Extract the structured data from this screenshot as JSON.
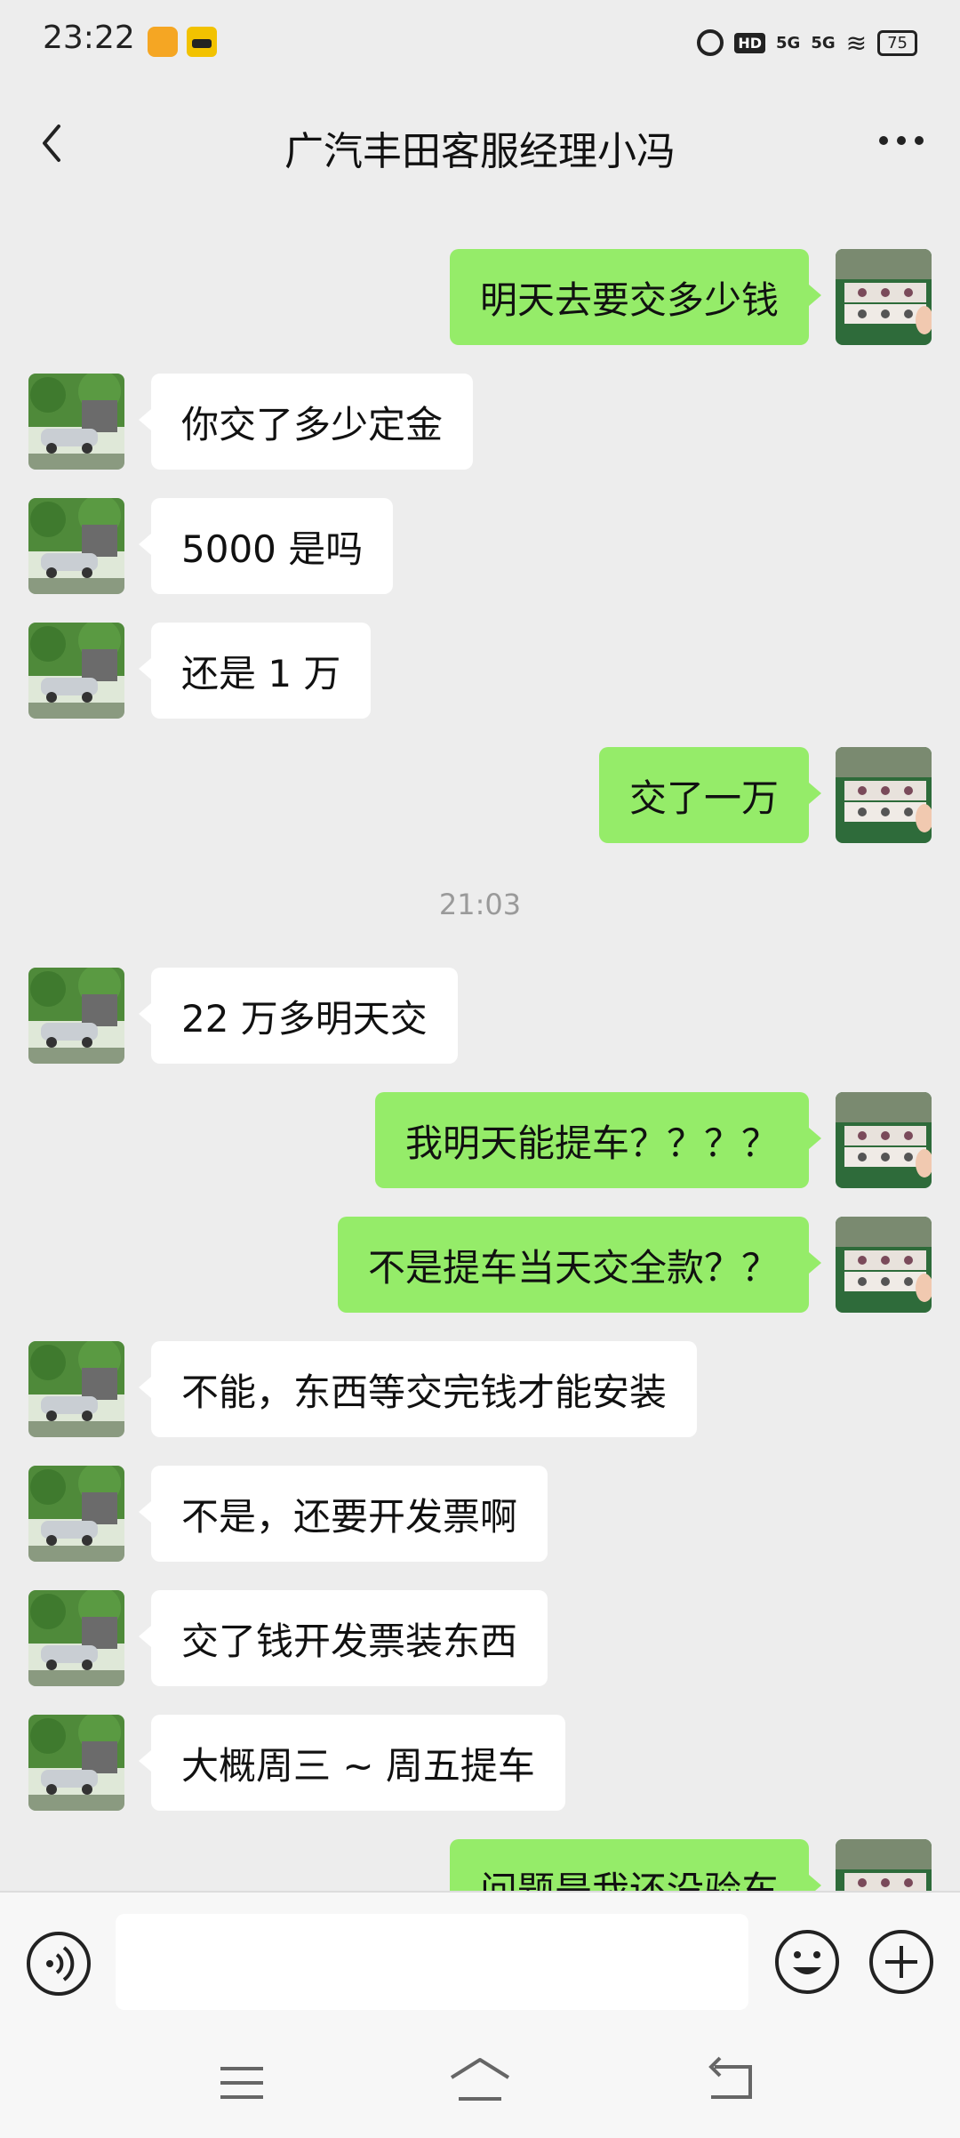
{
  "status_bar": {
    "time": "23:22",
    "hd_label": "HD",
    "network1": "5G",
    "network2": "5G",
    "battery": "75"
  },
  "header": {
    "title": "广汽丰田客服经理小冯"
  },
  "messages": [
    {
      "side": "right",
      "text": "明天去要交多少钱"
    },
    {
      "side": "left",
      "text": "你交了多少定金"
    },
    {
      "side": "left",
      "text": "5000 是吗"
    },
    {
      "side": "left",
      "text": "还是 1 万"
    },
    {
      "side": "right",
      "text": "交了一万"
    },
    {
      "type": "time",
      "text": "21:03"
    },
    {
      "side": "left",
      "text": "22 万多明天交"
    },
    {
      "side": "right",
      "text": "我明天能提车？？？？"
    },
    {
      "side": "right",
      "text": "不是提车当天交全款？？"
    },
    {
      "side": "left",
      "text": "不能，东西等交完钱才能安装"
    },
    {
      "side": "left",
      "text": "不是，还要开发票啊"
    },
    {
      "side": "left",
      "text": "交了钱开发票装东西"
    },
    {
      "side": "left",
      "text": "大概周三 ~ 周五提车"
    },
    {
      "side": "right",
      "text": "问题是我还没验车"
    }
  ],
  "input": {
    "placeholder": ""
  },
  "colors": {
    "background": "#ededed",
    "sent_bubble": "#95ec69",
    "received_bubble": "#ffffff"
  }
}
